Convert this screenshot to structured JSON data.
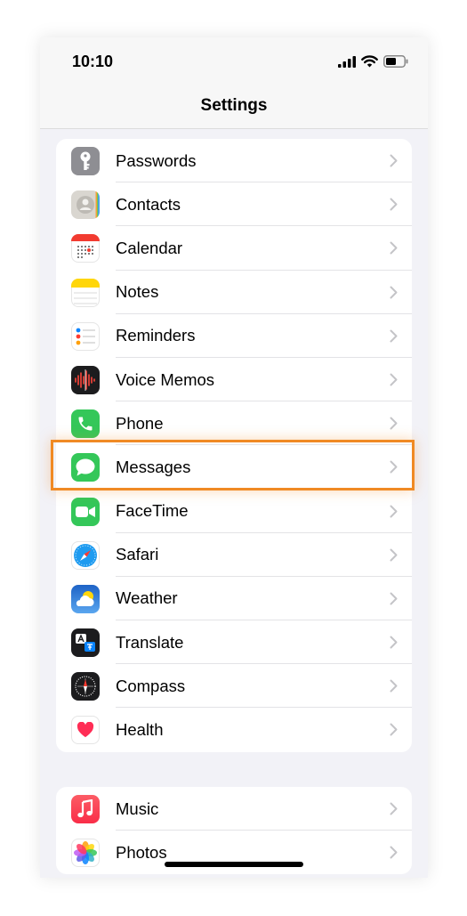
{
  "status_bar": {
    "time": "10:10"
  },
  "header": {
    "title": "Settings"
  },
  "group1": [
    {
      "label": "Passwords",
      "icon": "key-icon",
      "color": "#8e8e93"
    },
    {
      "label": "Contacts",
      "icon": "contacts-icon",
      "color": "#d9d6d0"
    },
    {
      "label": "Calendar",
      "icon": "calendar-icon",
      "color": "#ffffff"
    },
    {
      "label": "Notes",
      "icon": "notes-icon",
      "color": "#ffd60a"
    },
    {
      "label": "Reminders",
      "icon": "reminders-icon",
      "color": "#ffffff"
    },
    {
      "label": "Voice Memos",
      "icon": "voice-memos-icon",
      "color": "#1c1c1e"
    },
    {
      "label": "Phone",
      "icon": "phone-icon",
      "color": "#34c759"
    },
    {
      "label": "Messages",
      "icon": "messages-icon",
      "color": "#34c759"
    },
    {
      "label": "FaceTime",
      "icon": "facetime-icon",
      "color": "#34c759"
    },
    {
      "label": "Safari",
      "icon": "safari-icon",
      "color": "#ffffff"
    },
    {
      "label": "Weather",
      "icon": "weather-icon",
      "color": "#2f7ad9"
    },
    {
      "label": "Translate",
      "icon": "translate-icon",
      "color": "#1c1c1e"
    },
    {
      "label": "Compass",
      "icon": "compass-icon",
      "color": "#1c1c1e"
    },
    {
      "label": "Health",
      "icon": "health-icon",
      "color": "#ffffff"
    }
  ],
  "group2": [
    {
      "label": "Music",
      "icon": "music-icon",
      "color": "#fc3c44"
    },
    {
      "label": "Photos",
      "icon": "photos-icon",
      "color": "#ffffff"
    }
  ],
  "highlight_color": "#f08a24"
}
